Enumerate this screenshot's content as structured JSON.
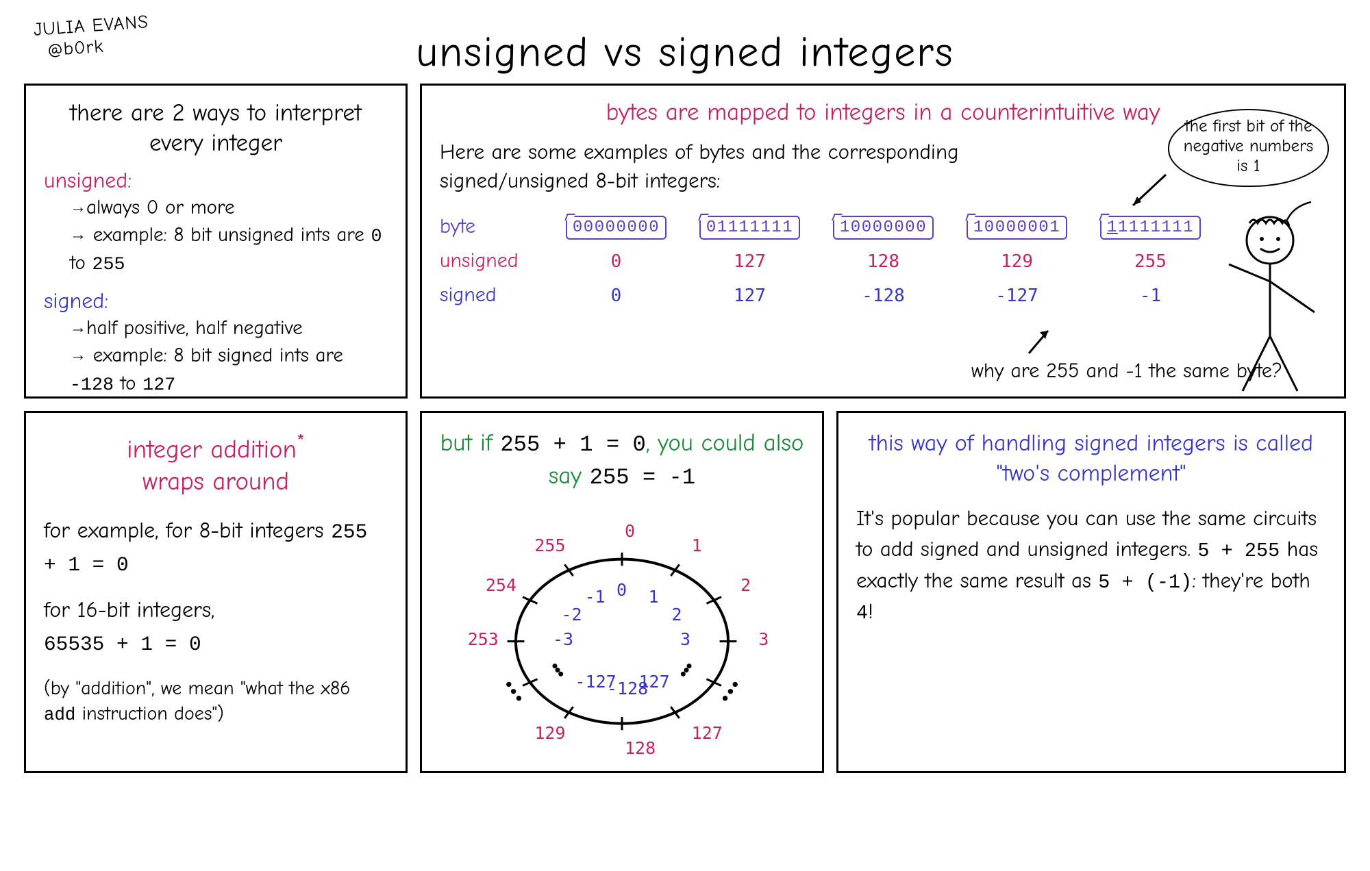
{
  "author": {
    "line1": "JULIA EVANS",
    "line2": "@b0rk"
  },
  "title": "unsigned vs signed integers",
  "panel1": {
    "heading": "there are 2 ways to interpret every integer",
    "unsigned_label": "unsigned:",
    "unsigned_b1": "always 0 or more",
    "unsigned_b2_a": "example: 8 bit unsigned ints are ",
    "unsigned_b2_r1": "0",
    "unsigned_b2_mid": " to ",
    "unsigned_b2_r2": "255",
    "signed_label": "signed:",
    "signed_b1": "half positive, half negative",
    "signed_b2_a": "example: 8 bit signed ints are ",
    "signed_b2_r1": "-128",
    "signed_b2_mid": " to ",
    "signed_b2_r2": "127"
  },
  "panel2": {
    "heading": "bytes are mapped to integers in a counterintuitive way",
    "sub": "Here are some examples of bytes and the corresponding signed/unsigned 8-bit integers:",
    "label_byte": "byte",
    "label_unsigned": "unsigned",
    "label_signed": "signed",
    "cols": [
      {
        "byte": "00000000",
        "u": "0",
        "s": "0"
      },
      {
        "byte": "01111111",
        "u": "127",
        "s": "127"
      },
      {
        "byte": "10000000",
        "u": "128",
        "s": "-128"
      },
      {
        "byte": "10000001",
        "u": "129",
        "s": "-127"
      },
      {
        "byte": "11111111",
        "u": "255",
        "s": "-1",
        "underline_first": true
      }
    ],
    "bubble": "the first bit of the negative numbers is 1",
    "question": "why are 255 and -1 the same byte?"
  },
  "panel3": {
    "heading_a": "integer addition",
    "heading_b": "wraps around",
    "body1_a": "for example, for 8-bit integers ",
    "body1_m": "255 + 1 = 0",
    "body2_a": "for 16-bit integers,",
    "body2_m": "65535 + 1 = 0",
    "foot_a": "(by \"addition\", we mean \"what the x86 ",
    "foot_m": "add",
    "foot_b": " instruction does\")"
  },
  "panel4": {
    "heading_a": "but if ",
    "heading_m1": "255 + 1 = 0",
    "heading_b": ", you could also say ",
    "heading_m2": "255 = -1",
    "ring": {
      "outer": [
        "0",
        "1",
        "2",
        "3",
        "",
        "127",
        "128",
        "129",
        "",
        "253",
        "254",
        "255"
      ],
      "inner": [
        "0",
        "1",
        "2",
        "3",
        "",
        "127",
        "-128",
        "-127",
        "",
        "-3",
        "-2",
        "-1"
      ]
    }
  },
  "panel5": {
    "heading": "this way of handling signed integers is called \"two's complement\"",
    "body_a": "It's popular because you can use the same circuits to add signed and unsigned integers. ",
    "body_m1": "5 + 255",
    "body_b": " has exactly the same result as ",
    "body_m2": "5 + (-1)",
    "body_c": ": they're both ",
    "body_m3": "4",
    "body_d": "!"
  }
}
